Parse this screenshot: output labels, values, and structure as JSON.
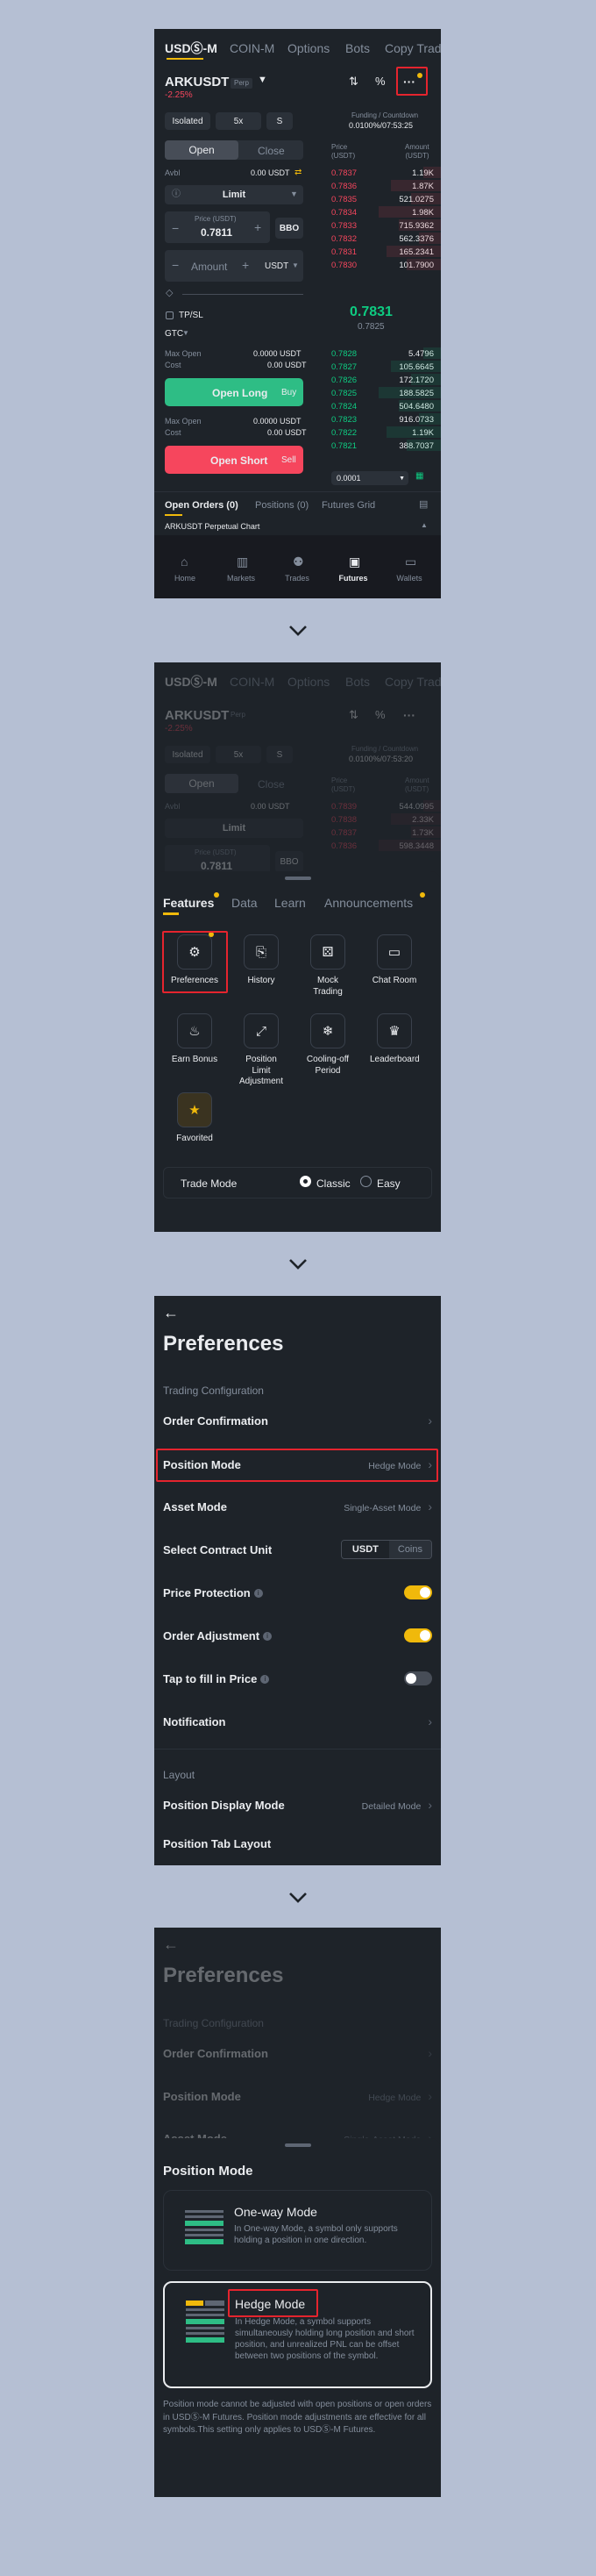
{
  "p1": {
    "tabs": [
      "USDⓈ-M",
      "COIN-M",
      "Options",
      "Bots",
      "Copy Trad"
    ],
    "symbol": "ARKUSDT",
    "perp": "Perp",
    "change": "-2.25%",
    "margin": "Isolated",
    "lev": "5x",
    "s": "S",
    "funding_lbl": "Funding / Countdown",
    "funding_val": "0.0100%/07:53:25",
    "open": "Open",
    "close": "Close",
    "avbl_lbl": "Avbl",
    "avbl_val": "0.00 USDT",
    "order_type": "Limit",
    "price_lbl": "Price (USDT)",
    "price_val": "0.7811",
    "bbo": "BBO",
    "amount_lbl": "Amount",
    "unit": "USDT",
    "tpsl": "TP/SL",
    "gtc": "GTC",
    "maxopen_lbl": "Max Open",
    "maxopen_val": "0.0000 USDT",
    "cost_lbl": "Cost",
    "cost_val": "0.00 USDT",
    "openlong": "Open Long",
    "buy": "Buy",
    "maxopen2_val": "0.0000 USDT",
    "cost2_val": "0.00 USDT",
    "openshort": "Open Short",
    "sell": "Sell",
    "ob_price_hdr": "Price\n(USDT)",
    "ob_amt_hdr": "Amount\n(USDT)",
    "asks": [
      [
        "0.7837",
        "1.19K"
      ],
      [
        "0.7836",
        "1.87K"
      ],
      [
        "0.7835",
        "521.0275"
      ],
      [
        "0.7834",
        "1.98K"
      ],
      [
        "0.7833",
        "715.9362"
      ],
      [
        "0.7832",
        "562.3376"
      ],
      [
        "0.7831",
        "165.2341"
      ],
      [
        "0.7830",
        "101.7900"
      ]
    ],
    "mid": "0.7831",
    "mark": "0.7825",
    "bids": [
      [
        "0.7828",
        "5.4796"
      ],
      [
        "0.7827",
        "105.6645"
      ],
      [
        "0.7826",
        "172.1720"
      ],
      [
        "0.7825",
        "188.5825"
      ],
      [
        "0.7824",
        "504.6480"
      ],
      [
        "0.7823",
        "916.0733"
      ],
      [
        "0.7822",
        "1.19K"
      ],
      [
        "0.7821",
        "388.7037"
      ]
    ],
    "prec": "0.0001",
    "bottom_tabs": [
      "Open Orders (0)",
      "Positions (0)",
      "Futures Grid"
    ],
    "chart_label": "ARKUSDT Perpetual  Chart",
    "nav": [
      "Home",
      "Markets",
      "Trades",
      "Futures",
      "Wallets"
    ]
  },
  "p2": {
    "tabs": [
      "USDⓈ-M",
      "COIN-M",
      "Options",
      "Bots",
      "Copy Trad"
    ],
    "symbol": "ARKUSDT",
    "perp": "Perp",
    "change": "-2.25%",
    "margin": "Isolated",
    "lev": "5x",
    "s": "S",
    "funding_lbl": "Funding / Countdown",
    "funding_val": "0.0100%/07:53:20",
    "open": "Open",
    "close": "Close",
    "avbl_lbl": "Avbl",
    "avbl_val": "0.00 USDT",
    "order_type": "Limit",
    "price_lbl": "Price (USDT)",
    "price_val": "0.7811",
    "bbo": "BBO",
    "ob_price_hdr": "Price\n(USDT)",
    "ob_amt_hdr": "Amount\n(USDT)",
    "asks": [
      [
        "0.7839",
        "544.0995"
      ],
      [
        "0.7838",
        "2.33K"
      ],
      [
        "0.7837",
        "1.73K"
      ],
      [
        "0.7836",
        "598.3448"
      ]
    ],
    "sheet_tabs": [
      "Features",
      "Data",
      "Learn",
      "Announcements"
    ],
    "features": [
      {
        "label": "Preferences",
        "icon": "gear-icon"
      },
      {
        "label": "History",
        "icon": "history-icon"
      },
      {
        "label": "Mock Trading",
        "icon": "mock-trading-icon"
      },
      {
        "label": "Chat Room",
        "icon": "chat-icon"
      },
      {
        "label": "Earn Bonus",
        "icon": "flame-icon"
      },
      {
        "label": "Position Limit Adjustment",
        "icon": "expand-icon"
      },
      {
        "label": "Cooling-off Period",
        "icon": "snowflake-icon"
      },
      {
        "label": "Leaderboard",
        "icon": "trophy-icon"
      },
      {
        "label": "Favorited",
        "icon": "star-icon"
      }
    ],
    "trade_mode_lbl": "Trade Mode",
    "classic": "Classic",
    "easy": "Easy"
  },
  "p3": {
    "title": "Preferences",
    "section1": "Trading Configuration",
    "order_confirmation": "Order Confirmation",
    "position_mode": "Position Mode",
    "position_mode_val": "Hedge Mode",
    "asset_mode": "Asset Mode",
    "asset_mode_val": "Single-Asset Mode",
    "contract_unit": "Select Contract Unit",
    "unit_usdt": "USDT",
    "unit_coins": "Coins",
    "price_protection": "Price Protection",
    "order_adjustment": "Order Adjustment",
    "tap_fill": "Tap to fill in Price",
    "notification": "Notification",
    "section2": "Layout",
    "position_display": "Position Display Mode",
    "position_display_val": "Detailed Mode",
    "position_tab": "Position Tab Layout",
    "price_protection_on": 1,
    "order_adjustment_on": 1,
    "tap_fill_on": 0
  },
  "p4": {
    "title": "Preferences",
    "section1": "Trading Configuration",
    "order_confirmation": "Order Confirmation",
    "position_mode": "Position Mode",
    "position_mode_val": "Hedge Mode",
    "asset_mode": "Asset Mode",
    "asset_mode_val": "Single-Asset Mode",
    "sheet_title": "Position Mode",
    "oneway_title": "One-way Mode",
    "oneway_desc": "In One-way Mode, a symbol only supports holding a position in one direction.",
    "hedge_title": "Hedge Mode",
    "hedge_desc": "In Hedge Mode, a symbol supports simultaneously holding long position and short position, and unrealized PNL can be offset between two positions of the symbol.",
    "note": "Position mode cannot be adjusted with open positions or open orders in USDⓈ-M Futures. Position mode adjustments are effective for all symbols.This setting only applies to USDⓈ-M Futures."
  },
  "colors": {
    "bg": "#1e2329",
    "red": "#f6465d",
    "green": "#0ecb81",
    "yellow": "#f0b90b",
    "highlight": "#e5242e"
  }
}
